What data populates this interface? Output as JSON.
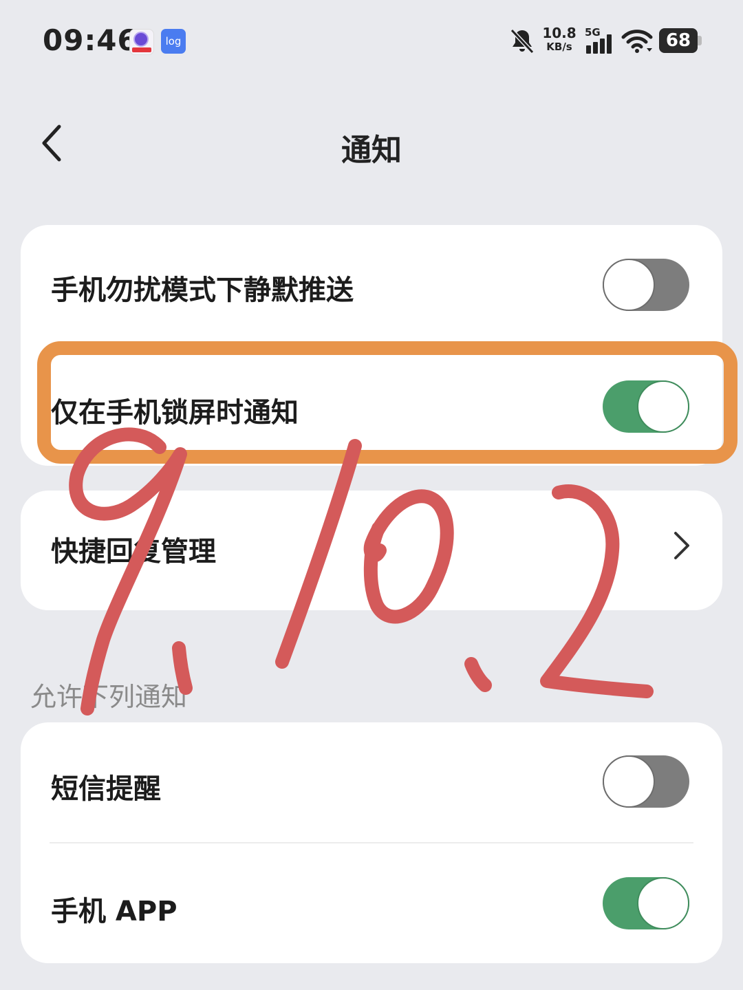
{
  "status_bar": {
    "time": "09:46",
    "app_icon_2_label": "log",
    "net_speed_value": "10.8",
    "net_speed_unit": "KB/s",
    "network_type": "5G",
    "battery_level": "68"
  },
  "header": {
    "title": "通知"
  },
  "settings_card_1": {
    "rows": [
      {
        "label": "手机勿扰模式下静默推送",
        "toggle_on": false
      },
      {
        "label": "仅在手机锁屏时通知",
        "toggle_on": true
      }
    ]
  },
  "quick_reply": {
    "label": "快捷回复管理"
  },
  "allowed_section": {
    "header": "允许下列通知",
    "rows": [
      {
        "label": "短信提醒",
        "toggle_on": false
      },
      {
        "label": "手机 APP",
        "toggle_on": true
      }
    ]
  },
  "annotation": {
    "handwritten_text": "9.10.2",
    "highlight_color": "#e8944a",
    "ink_color": "#d9534f"
  },
  "colors": {
    "toggle_on": "#4b9e6b",
    "toggle_off": "#7d7d7d",
    "background": "#e9eaee"
  }
}
